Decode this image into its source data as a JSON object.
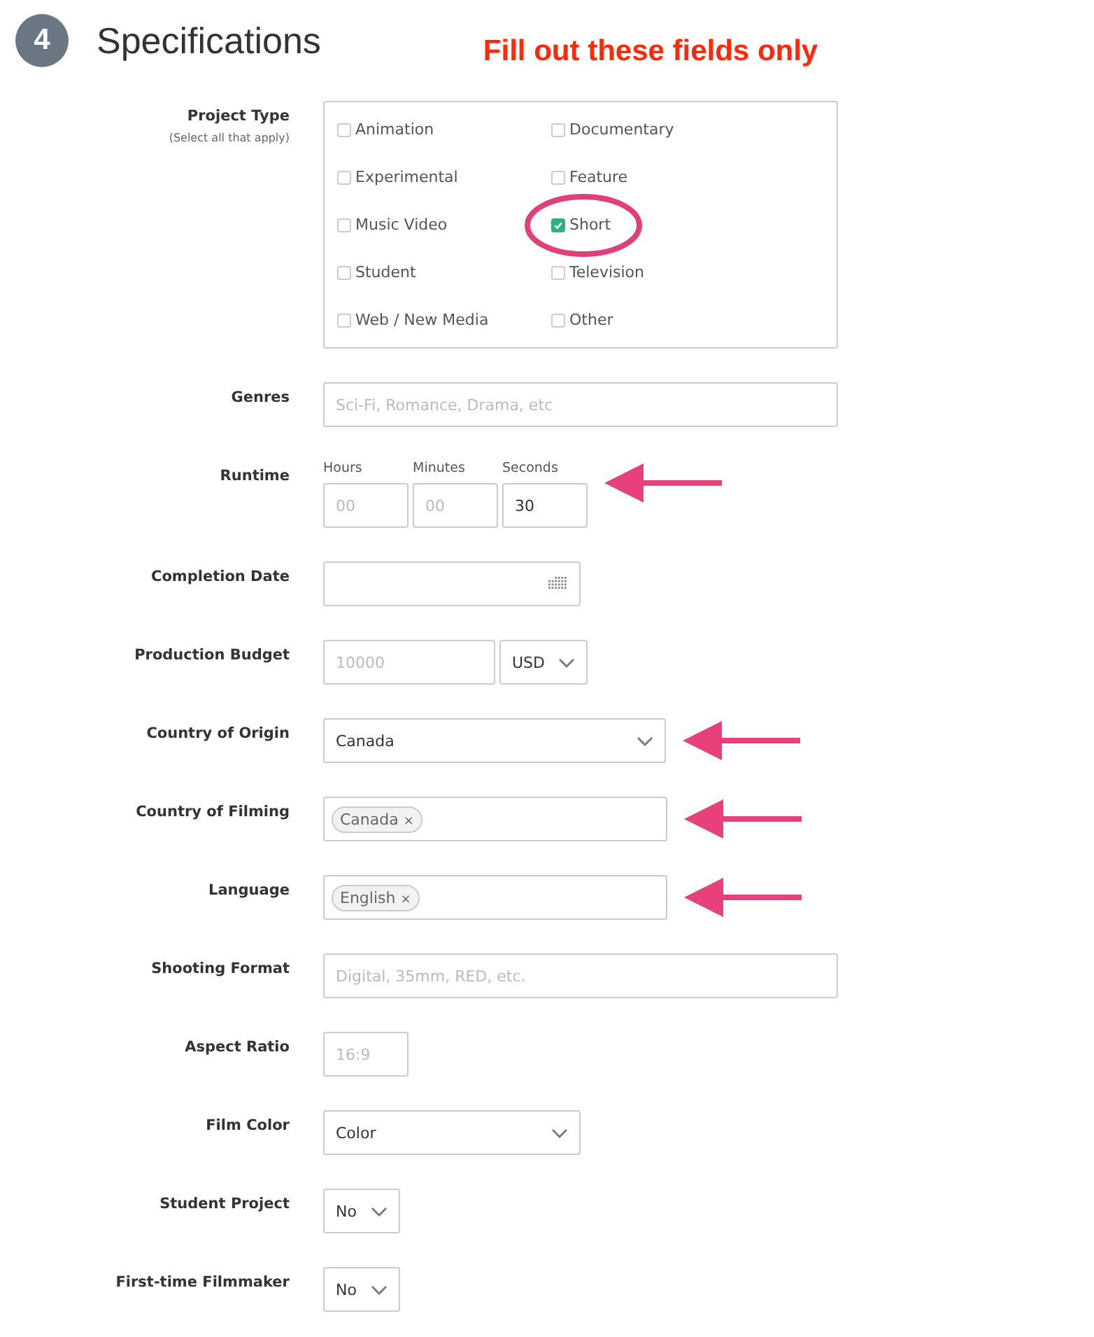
{
  "header": {
    "step": "4",
    "title": "Specifications",
    "note": "Fill out these fields only"
  },
  "fields": [
    {
      "kind": "checkgroup",
      "label": "Project Type",
      "hint": "(Select all that apply)",
      "arrow": false,
      "options": [
        {
          "label": "Animation",
          "checked": false,
          "circled": false
        },
        {
          "label": "Documentary",
          "checked": false,
          "circled": false
        },
        {
          "label": "Experimental",
          "checked": false,
          "circled": false
        },
        {
          "label": "Feature",
          "checked": false,
          "circled": false
        },
        {
          "label": "Music Video",
          "checked": false,
          "circled": false
        },
        {
          "label": "Short",
          "checked": true,
          "circled": true
        },
        {
          "label": "Student",
          "checked": false,
          "circled": false
        },
        {
          "label": "Television",
          "checked": false,
          "circled": false
        },
        {
          "label": "Web / New Media",
          "checked": false,
          "circled": false
        },
        {
          "label": "Other",
          "checked": false,
          "circled": false
        }
      ]
    },
    {
      "kind": "text",
      "label": "Genres",
      "placeholder": "Sci-Fi, Romance, Drama, etc",
      "arrow": false
    },
    {
      "kind": "runtime",
      "label": "Runtime",
      "arrow": true,
      "parts": [
        {
          "caption": "Hours",
          "placeholder": "00"
        },
        {
          "caption": "Minutes",
          "placeholder": "00"
        },
        {
          "caption": "Seconds",
          "value": "30"
        }
      ]
    },
    {
      "kind": "date",
      "label": "Completion Date",
      "arrow": false
    },
    {
      "kind": "budget",
      "label": "Production Budget",
      "placeholder": "10000",
      "currency": "USD",
      "arrow": false
    },
    {
      "kind": "select",
      "label": "Country of Origin",
      "value": "Canada",
      "arrow": true
    },
    {
      "kind": "tags",
      "label": "Country of Filming",
      "tags": [
        {
          "label": "Canada",
          "remove": "×"
        }
      ],
      "arrow": true
    },
    {
      "kind": "tags",
      "label": "Language",
      "tags": [
        {
          "label": "English",
          "remove": "×"
        }
      ],
      "arrow": true
    },
    {
      "kind": "text",
      "label": "Shooting Format",
      "placeholder": "Digital, 35mm, RED, etc.",
      "arrow": false
    },
    {
      "kind": "text",
      "label": "Aspect Ratio",
      "placeholder": "16:9",
      "arrow": false
    },
    {
      "kind": "select",
      "label": "Film Color",
      "value": "Color",
      "arrow": false
    },
    {
      "kind": "select",
      "label": "Student Project",
      "value": "No",
      "arrow": false
    },
    {
      "kind": "select",
      "label": "First-time Filmmaker",
      "value": "No",
      "arrow": false
    }
  ]
}
